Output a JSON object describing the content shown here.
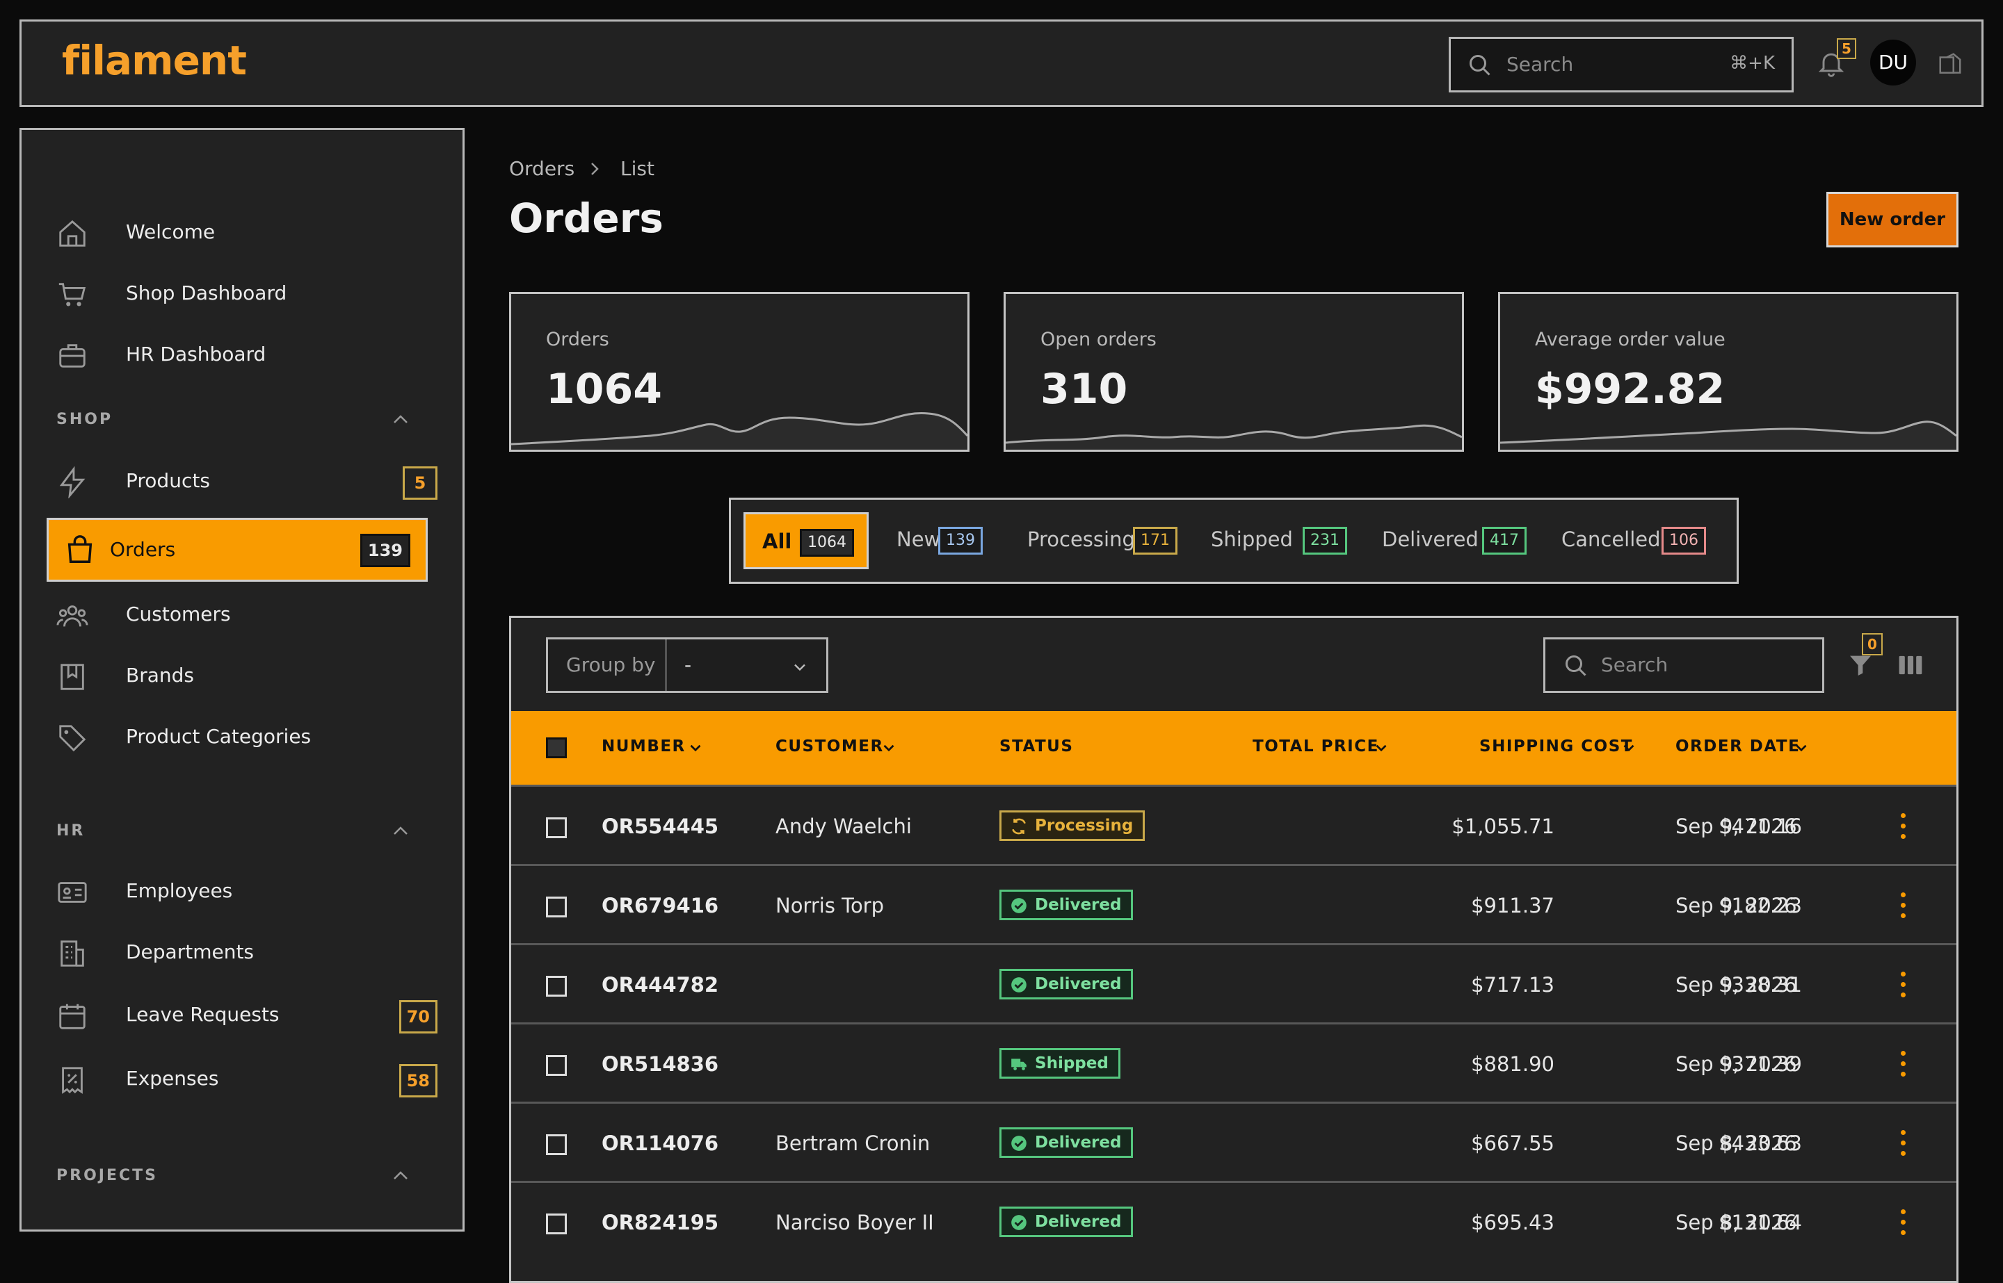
{
  "brand": {
    "name": "filament",
    "color": "#f6a02b"
  },
  "topbar": {
    "search_placeholder": "Search",
    "search_shortcut": "⌘+K",
    "notifications_count": "5",
    "avatar_initials": "DU"
  },
  "sidebar": {
    "items": [
      {
        "label": "Welcome",
        "icon": "home-icon"
      },
      {
        "label": "Shop Dashboard",
        "icon": "cart-icon"
      },
      {
        "label": "HR Dashboard",
        "icon": "briefcase-icon"
      }
    ],
    "groups": {
      "shop": {
        "label": "SHOP",
        "items": [
          {
            "label": "Products",
            "icon": "bolt-icon",
            "badge": "5"
          },
          {
            "label": "Orders",
            "icon": "shopping-bag-icon",
            "badge": "139",
            "active": true
          },
          {
            "label": "Customers",
            "icon": "users-icon"
          },
          {
            "label": "Brands",
            "icon": "bookmark-icon"
          },
          {
            "label": "Product Categories",
            "icon": "tag-icon"
          }
        ]
      },
      "hr": {
        "label": "HR",
        "items": [
          {
            "label": "Employees",
            "icon": "id-card-icon"
          },
          {
            "label": "Departments",
            "icon": "building-icon"
          },
          {
            "label": "Leave Requests",
            "icon": "calendar-icon",
            "badge": "70"
          },
          {
            "label": "Expenses",
            "icon": "receipt-icon",
            "badge": "58"
          }
        ]
      },
      "projects": {
        "label": "PROJECTS"
      }
    }
  },
  "breadcrumb": {
    "parent": "Orders",
    "current": "List"
  },
  "page": {
    "title": "Orders",
    "new_button": "New order"
  },
  "stats": [
    {
      "label": "Orders",
      "value": "1064"
    },
    {
      "label": "Open orders",
      "value": "310"
    },
    {
      "label": "Average order value",
      "value": "$992.82"
    }
  ],
  "tabs": [
    {
      "label": "All",
      "count": "1064",
      "active": true
    },
    {
      "label": "New",
      "count": "139",
      "color": "#7aa7e0"
    },
    {
      "label": "Processing",
      "count": "171",
      "color": "#e7b23c"
    },
    {
      "label": "Shipped",
      "count": "231",
      "color": "#55c77e"
    },
    {
      "label": "Delivered",
      "count": "417",
      "color": "#55c77e"
    },
    {
      "label": "Cancelled",
      "count": "106",
      "color": "#e58a8a"
    }
  ],
  "table": {
    "group_by_label": "Group by",
    "group_by_value": "-",
    "search_placeholder": "Search",
    "filter_count": "0",
    "columns": [
      "NUMBER",
      "CUSTOMER",
      "STATUS",
      "TOTAL PRICE",
      "SHIPPING COST",
      "ORDER DATE"
    ],
    "rows": [
      {
        "number": "OR554445",
        "customer": "Andy Waelchi",
        "status": "Processing",
        "total": "$1,055.71",
        "shipping": "$471.16",
        "date": "Sep 9, 2026"
      },
      {
        "number": "OR679416",
        "customer": "Norris Torp",
        "status": "Delivered",
        "total": "$911.37",
        "shipping": "$182.23",
        "date": "Sep 9, 2026"
      },
      {
        "number": "OR444782",
        "customer": "",
        "status": "Delivered",
        "total": "$717.13",
        "shipping": "$338.31",
        "date": "Sep 9, 2026"
      },
      {
        "number": "OR514836",
        "customer": "",
        "status": "Shipped",
        "total": "$881.90",
        "shipping": "$371.39",
        "date": "Sep 9, 2026"
      },
      {
        "number": "OR114076",
        "customer": "Bertram Cronin",
        "status": "Delivered",
        "total": "$667.55",
        "shipping": "$433.63",
        "date": "Sep 8, 2026"
      },
      {
        "number": "OR824195",
        "customer": "Narciso Boyer II",
        "status": "Delivered",
        "total": "$695.43",
        "shipping": "$131.64",
        "date": "Sep 8, 2026"
      }
    ]
  },
  "colors": {
    "accent": "#f99b00",
    "processing": "#e7b23c",
    "delivered": "#55c77e",
    "shipped": "#55c77e"
  }
}
